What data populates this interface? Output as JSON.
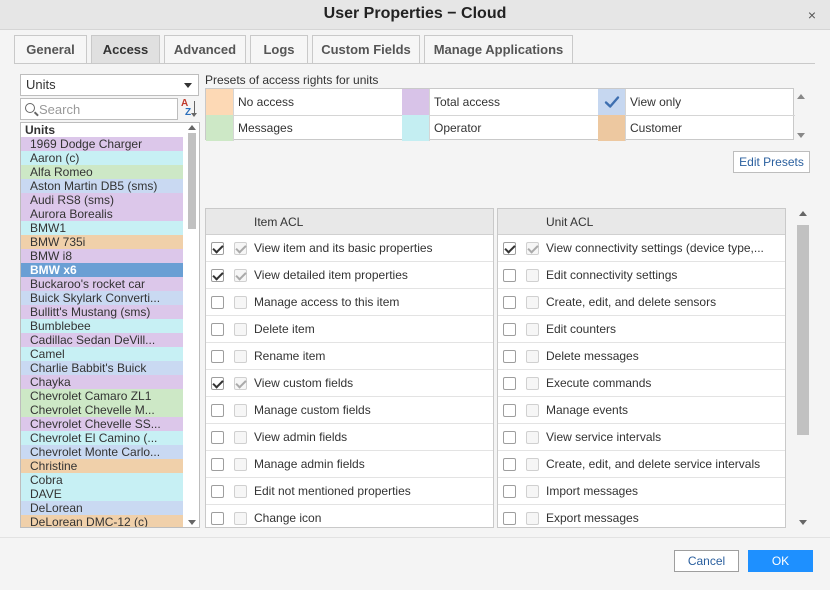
{
  "window": {
    "title": "User Properties − Cloud",
    "close": "×"
  },
  "tabs": [
    {
      "label": "General"
    },
    {
      "label": "Access",
      "active": true
    },
    {
      "label": "Advanced"
    },
    {
      "label": "Logs"
    },
    {
      "label": "Custom Fields"
    },
    {
      "label": "Manage Applications"
    }
  ],
  "sidebar": {
    "selector": "Units",
    "search_placeholder": "Search",
    "sort_icon": "sort-az-icon",
    "list_header": "Units",
    "units": [
      {
        "name": "1969 Dodge Charger",
        "color": "#dcc7ea"
      },
      {
        "name": "Aaron (c)",
        "color": "#c7f0f4"
      },
      {
        "name": "Alfa Romeo",
        "color": "#cde8c6"
      },
      {
        "name": "Aston Martin DB5 (sms)",
        "color": "#c9d9f2"
      },
      {
        "name": "Audi RS8 (sms)",
        "color": "#dcc7ea"
      },
      {
        "name": "Aurora Borealis",
        "color": "#dcc7ea"
      },
      {
        "name": "BMW1",
        "color": "#c7f0f4"
      },
      {
        "name": "BMW 735i",
        "color": "#f0d0aa"
      },
      {
        "name": "BMW i8",
        "color": "#dcc7ea"
      },
      {
        "name": "BMW x6",
        "color": "#6a9fd4",
        "selected": true
      },
      {
        "name": "Buckaroo's rocket car",
        "color": "#dcc7ea"
      },
      {
        "name": "Buick Skylark Converti...",
        "color": "#c9d9f2"
      },
      {
        "name": "Bullitt's Mustang (sms)",
        "color": "#dcc7ea"
      },
      {
        "name": "Bumblebee",
        "color": "#c7f0f4"
      },
      {
        "name": "Cadillac Sedan DeVill...",
        "color": "#dcc7ea"
      },
      {
        "name": "Camel",
        "color": "#c7f0f4"
      },
      {
        "name": "Charlie Babbit's Buick",
        "color": "#c9d9f2"
      },
      {
        "name": "Chayka",
        "color": "#dcc7ea"
      },
      {
        "name": "Chevrolet Camaro ZL1",
        "color": "#cde8c6"
      },
      {
        "name": "Chevrolet Chevelle M...",
        "color": "#cde8c6"
      },
      {
        "name": "Chevrolet Chevelle SS...",
        "color": "#dcc7ea"
      },
      {
        "name": "Chevrolet El Camino (...",
        "color": "#c7f0f4"
      },
      {
        "name": "Chevrolet Monte Carlo...",
        "color": "#c9d9f2"
      },
      {
        "name": "Christine",
        "color": "#f0d0aa"
      },
      {
        "name": "Cobra",
        "color": "#c7f0f4"
      },
      {
        "name": "DAVE",
        "color": "#c7f0f4"
      },
      {
        "name": "DeLorean",
        "color": "#c9d9f2"
      },
      {
        "name": "DeLorean DMC-12 (c)",
        "color": "#f0d0aa"
      }
    ]
  },
  "presets": {
    "title": "Presets of access rights for units",
    "items": [
      {
        "label": "No access",
        "color": "#fdd9b5"
      },
      {
        "label": "Total access",
        "color": "#d8c3e8"
      },
      {
        "label": "View only",
        "color": "#c6d7f0",
        "checked": true
      },
      {
        "label": "Messages",
        "color": "#cde8c6"
      },
      {
        "label": "Operator",
        "color": "#c4eef2"
      },
      {
        "label": "Customer",
        "color": "#edc8a0"
      }
    ],
    "edit_button": "Edit Presets"
  },
  "item_acl": {
    "header": "Item ACL",
    "rows": [
      {
        "label": "View item and its basic properties",
        "checked": true
      },
      {
        "label": "View detailed item properties",
        "checked": true
      },
      {
        "label": "Manage access to this item",
        "checked": false
      },
      {
        "label": "Delete item",
        "checked": false
      },
      {
        "label": "Rename item",
        "checked": false
      },
      {
        "label": "View custom fields",
        "checked": true
      },
      {
        "label": "Manage custom fields",
        "checked": false
      },
      {
        "label": "View admin fields",
        "checked": false
      },
      {
        "label": "Manage admin fields",
        "checked": false
      },
      {
        "label": "Edit not mentioned properties",
        "checked": false
      },
      {
        "label": "Change icon",
        "checked": false
      }
    ]
  },
  "unit_acl": {
    "header": "Unit ACL",
    "rows": [
      {
        "label": "View connectivity settings (device type,...",
        "checked": true
      },
      {
        "label": "Edit connectivity settings",
        "checked": false
      },
      {
        "label": "Create, edit, and delete sensors",
        "checked": false
      },
      {
        "label": "Edit counters",
        "checked": false
      },
      {
        "label": "Delete messages",
        "checked": false
      },
      {
        "label": "Execute commands",
        "checked": false
      },
      {
        "label": "Manage events",
        "checked": false
      },
      {
        "label": "View service intervals",
        "checked": false
      },
      {
        "label": "Create, edit, and delete service intervals",
        "checked": false
      },
      {
        "label": "Import messages",
        "checked": false
      },
      {
        "label": "Export messages",
        "checked": false
      }
    ]
  },
  "footer": {
    "cancel": "Cancel",
    "ok": "OK"
  }
}
